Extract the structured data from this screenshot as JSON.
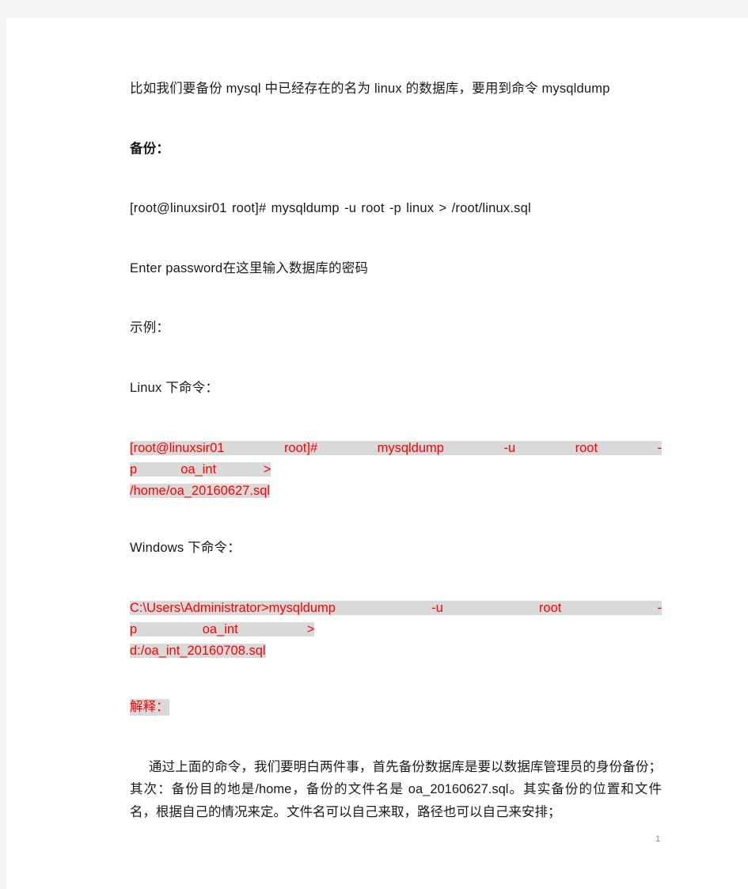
{
  "document": {
    "page_number": "1",
    "paragraphs": [
      {
        "id": "intro",
        "text": "比如我们要备份 mysql 中已经存在的名为 linux 的数据库，要用到命令 mysqldump"
      },
      {
        "id": "backup_heading",
        "text": "备份："
      },
      {
        "id": "backup_command",
        "text": "[root@linuxsir01 root]# mysqldump -u root -p linux > /root/linux.sql"
      },
      {
        "id": "enter_password",
        "text": "Enter password在这里输入数据库的密码"
      },
      {
        "id": "example_label",
        "text": "示例："
      },
      {
        "id": "linux_label",
        "text": "Linux 下命令："
      },
      {
        "id": "windows_label",
        "text": "Windows 下命令："
      }
    ],
    "linux_command": {
      "tokens": [
        "[root@linuxsir01",
        "root]#",
        "mysqldump",
        "-u",
        "root",
        "-p",
        "oa_int",
        ">"
      ],
      "wrapped": "/home/oa_20160627.sql",
      "full": "[root@linuxsir01 root]# mysqldump -u root -p oa_int > /home/oa_20160627.sql"
    },
    "windows_command": {
      "tokens": [
        "C:\\Users\\Administrator>mysqldump",
        "-u",
        "root",
        "-p",
        "oa_int",
        ">"
      ],
      "wrapped": "d:/oa_int_20160708.sql",
      "full": "C:\\Users\\Administrator>mysqldump -u root -p oa_int > d:/oa_int_20160708.sql"
    },
    "explain_label": "解释：",
    "explanation": "通过上面的命令，我们要明白两件事，首先备份数据库是要以数据库管理员的身份备份；其次：备份目的地是/home，备份的文件名是 oa_20160627.sql。其实备份的位置和文件名，根据自己的情况来定。文件名可以自己来取，路径也可以自己来安排；"
  },
  "colors": {
    "command_red": "#ff0000",
    "highlight_gray": "#d9d9d9",
    "page_frame": "#f4f4f4",
    "body_text": "#1a1a1a",
    "page_number": "#7a8aa0"
  }
}
